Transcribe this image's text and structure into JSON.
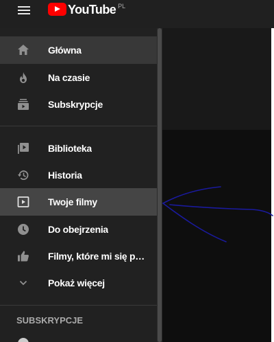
{
  "header": {
    "logo_text": "YouTube",
    "region_label": "PL",
    "logo_color": "#ff0000"
  },
  "sidebar": {
    "items": [
      {
        "label": "Główna",
        "icon": "home-icon"
      },
      {
        "label": "Na czasie",
        "icon": "fire-icon"
      },
      {
        "label": "Subskrypcje",
        "icon": "subscriptions-icon"
      },
      {
        "label": "Biblioteka",
        "icon": "library-icon"
      },
      {
        "label": "Historia",
        "icon": "history-icon"
      },
      {
        "label": "Twoje filmy",
        "icon": "your-videos-icon"
      },
      {
        "label": "Do obejrzenia",
        "icon": "clock-icon"
      },
      {
        "label": "Filmy, które mi się po...",
        "icon": "thumbs-up-icon"
      },
      {
        "label": "Pokaż więcej",
        "icon": "chevron-down-icon"
      }
    ],
    "subscriptions_title": "SUBSKRYPCJE"
  },
  "theme": {
    "sidebar_bg": "#212121",
    "active_bg": "#383838",
    "annotation_color": "#1a1a9e"
  }
}
